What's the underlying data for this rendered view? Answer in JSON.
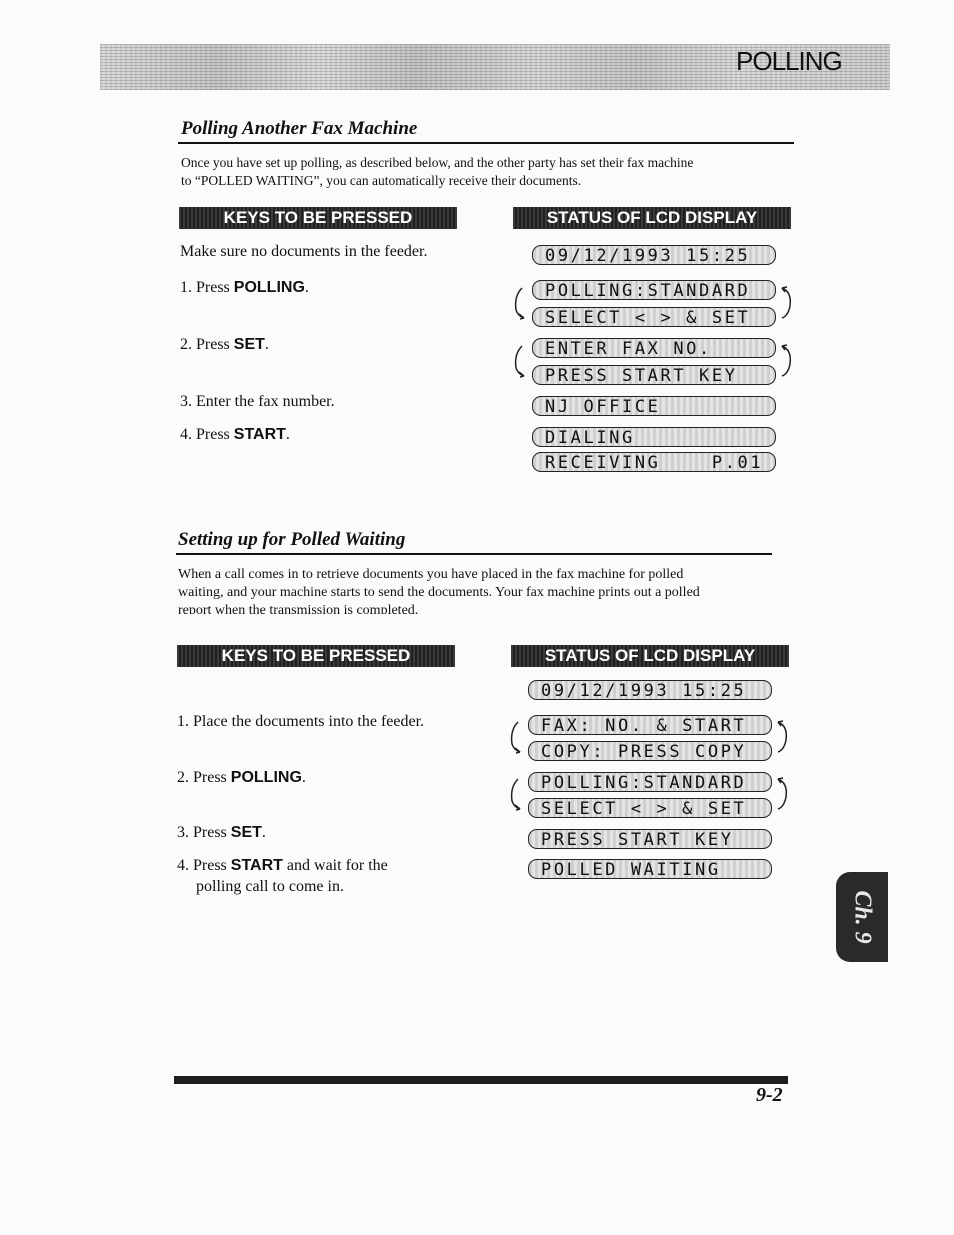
{
  "header": {
    "title": "POLLING"
  },
  "section1": {
    "title": "Polling Another Fax Machine",
    "intro_line1": "Once you have set up polling, as described below, and the other party has set their fax machine",
    "intro_line2": "to “POLLED WAITING”, you can automatically receive their documents.",
    "keys_header": "KEYS TO BE PRESSED",
    "lcd_header": "STATUS OF LCD DISPLAY",
    "pre_note": "Make sure no documents in the feeder.",
    "steps": [
      {
        "num": "1.",
        "text": "Press ",
        "key": "POLLING",
        "suffix": "."
      },
      {
        "num": "2.",
        "text": "Press ",
        "key": "SET",
        "suffix": "."
      },
      {
        "num": "3.",
        "text": "Enter the fax number.",
        "key": "",
        "suffix": ""
      },
      {
        "num": "4.",
        "text": "Press ",
        "key": "START",
        "suffix": "."
      }
    ],
    "lcd": [
      "09/12/1993 15:25",
      "POLLING:STANDARD",
      "SELECT < > & SET",
      "ENTER FAX NO.",
      "PRESS START KEY",
      "NJ OFFICE",
      "DIALING",
      "RECEIVING    P.01"
    ]
  },
  "section2": {
    "title": "Setting up for Polled Waiting",
    "intro_line1": "When a call comes in to retrieve documents you have placed in the fax machine for polled",
    "intro_line2": "waiting, and your machine starts to send the documents. Your fax machine prints out a polled",
    "intro_line3": "report when the transmission is completed.",
    "keys_header": "KEYS TO BE PRESSED",
    "lcd_header": "STATUS OF LCD DISPLAY",
    "steps": [
      {
        "num": "1.",
        "text": "Place the documents into the feeder.",
        "key": "",
        "suffix": ""
      },
      {
        "num": "2.",
        "text": "Press ",
        "key": "POLLING",
        "suffix": "."
      },
      {
        "num": "3.",
        "text": "Press ",
        "key": "SET",
        "suffix": "."
      },
      {
        "num": "4.",
        "text": "Press ",
        "key": "START",
        "suffix": " and wait for the",
        "cont": "polling call to come in."
      }
    ],
    "lcd": [
      "09/12/1993 15:25",
      "FAX: NO. & START",
      "COPY: PRESS COPY",
      "POLLING:STANDARD",
      "SELECT < > & SET",
      "PRESS START KEY",
      "POLLED WAITING"
    ]
  },
  "chapter_tab": "Ch. 9",
  "footer": {
    "page_number": "9-2"
  }
}
